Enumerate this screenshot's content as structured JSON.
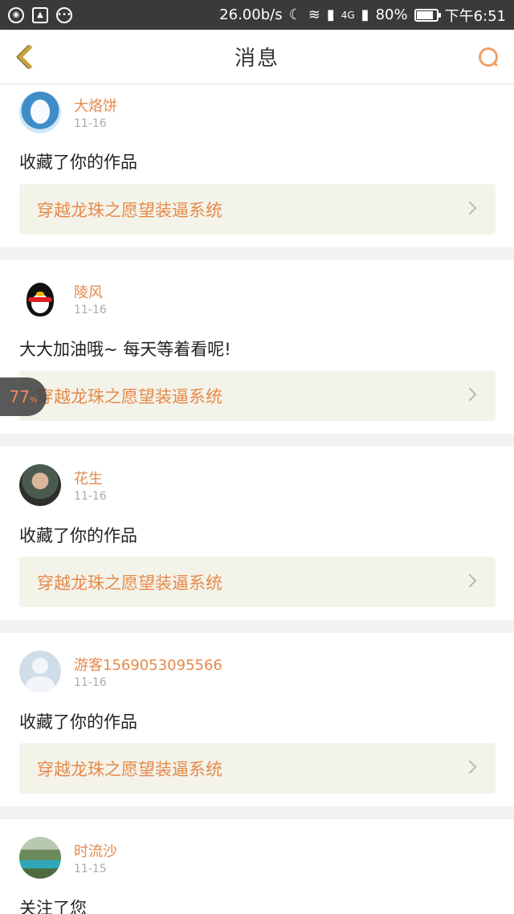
{
  "status_bar": {
    "speed": "26.00b/s",
    "network": "4G",
    "battery": "80%",
    "battery_level": 0.8,
    "time": "下午6:51"
  },
  "header": {
    "title": "消息"
  },
  "feed": [
    {
      "user": "大烙饼",
      "date": "11-16",
      "message": "收藏了你的作品",
      "work_title": "穿越龙珠之愿望装逼系统"
    },
    {
      "user": "陵风",
      "date": "11-16",
      "message": "大大加油哦~ 每天等着看呢!",
      "work_title": "穿越龙珠之愿望装逼系统"
    },
    {
      "user": "花生",
      "date": "11-16",
      "message": "收藏了你的作品",
      "work_title": "穿越龙珠之愿望装逼系统"
    },
    {
      "user": "游客1569053095566",
      "date": "11-16",
      "message": "收藏了你的作品",
      "work_title": "穿越龙珠之愿望装逼系统"
    },
    {
      "user": "时流沙",
      "date": "11-15",
      "message": "关注了您"
    }
  ],
  "float_widget": {
    "value": "77",
    "unit": "%"
  },
  "colors": {
    "accent": "#e58a4a",
    "back_icon": "#c5a23a",
    "link_bg": "#f4f3ea"
  }
}
